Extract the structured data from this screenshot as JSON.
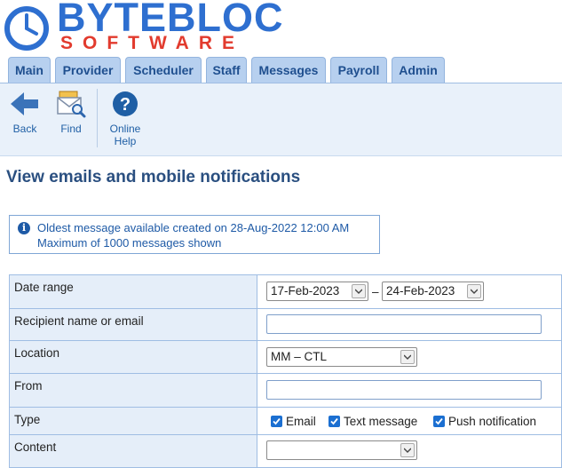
{
  "logo": {
    "word": "BYTEBLOC",
    "sub": "SOFTWARE"
  },
  "tabs": [
    {
      "label": "Main"
    },
    {
      "label": "Provider"
    },
    {
      "label": "Scheduler"
    },
    {
      "label": "Staff"
    },
    {
      "label": "Messages"
    },
    {
      "label": "Payroll"
    },
    {
      "label": "Admin"
    }
  ],
  "toolbar": {
    "back_label": "Back",
    "find_label": "Find",
    "help_line1": "Online",
    "help_line2": "Help"
  },
  "page_title": "View emails and mobile notifications",
  "info": {
    "line1": "Oldest message available created on 28-Aug-2022 12:00 AM",
    "line2": "Maximum of 1000 messages shown"
  },
  "form": {
    "date_range": {
      "label": "Date range",
      "from": "17-Feb-2023",
      "separator": "–",
      "to": "24-Feb-2023"
    },
    "recipient": {
      "label": "Recipient name or email",
      "value": ""
    },
    "location": {
      "label": "Location",
      "value": "MM – CTL"
    },
    "from": {
      "label": "From",
      "value": ""
    },
    "type": {
      "label": "Type",
      "options": [
        {
          "label": "Email",
          "checked": true
        },
        {
          "label": "Text message",
          "checked": true
        },
        {
          "label": "Push notification",
          "checked": true
        }
      ]
    },
    "content": {
      "label": "Content",
      "value": ""
    }
  },
  "colors": {
    "logo_blue": "#2e6fd0",
    "logo_red": "#e23b2e",
    "tab_bg": "#b7d0ef",
    "heading": "#2a4f80",
    "checkbox": "#1b6fd1"
  }
}
